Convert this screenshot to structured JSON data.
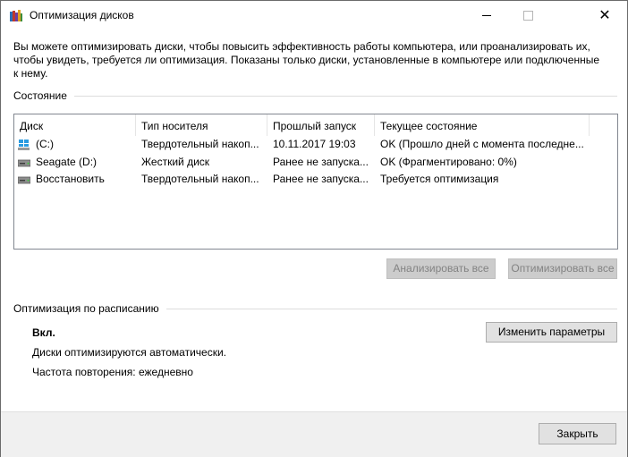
{
  "window": {
    "title": "Оптимизация дисков",
    "close_glyph": "✕"
  },
  "description": "Вы можете оптимизировать диски, чтобы повысить эффективность работы  компьютера, или проанализировать их, чтобы увидеть, требуется ли оптимизация. Показаны только диски, установленные в компьютере или подключенные к нему.",
  "status": {
    "label": "Состояние",
    "columns": [
      "Диск",
      "Тип носителя",
      "Прошлый запуск",
      "Текущее состояние"
    ],
    "rows": [
      {
        "drive": "(C:)",
        "icon": "windows-drive-icon",
        "media": "Твердотельный накоп...",
        "last_run": "10.11.2017 19:03",
        "state": "OK (Прошло дней с момента последне..."
      },
      {
        "drive": "Seagate (D:)",
        "icon": "hard-drive-icon",
        "media": "Жесткий диск",
        "last_run": "Ранее не запуска...",
        "state": "OK (Фрагментировано: 0%)"
      },
      {
        "drive": "Восстановить",
        "icon": "hard-drive-icon",
        "media": "Твердотельный накоп...",
        "last_run": "Ранее не запуска...",
        "state": "Требуется оптимизация"
      }
    ],
    "analyze_all": "Анализировать все",
    "optimize_all": "Оптимизировать все"
  },
  "schedule": {
    "label": "Оптимизация по расписанию",
    "status": "Вкл.",
    "auto_text": "Диски оптимизируются автоматически.",
    "frequency": "Частота повторения: ежедневно",
    "change_button": "Изменить параметры"
  },
  "footer": {
    "close_button": "Закрыть"
  }
}
